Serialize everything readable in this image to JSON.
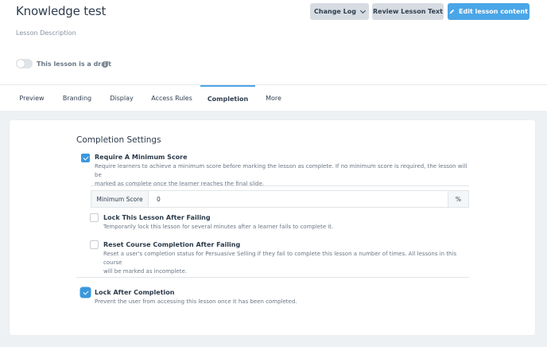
{
  "header": {
    "title": "Knowledge test",
    "description": "Lesson Description",
    "change_log_label": "Change Log",
    "review_label": "Review Lesson Text",
    "edit_label": "Edit lesson content",
    "draft_label": "This lesson is a draft",
    "draft_enabled": false,
    "info_glyph": "i"
  },
  "tabs": [
    {
      "label": "Preview"
    },
    {
      "label": "Branding"
    },
    {
      "label": "Display"
    },
    {
      "label": "Access Rules"
    },
    {
      "label": "Completion",
      "active": true
    },
    {
      "label": "More"
    }
  ],
  "completion": {
    "title": "Completion Settings",
    "min_score": {
      "checked": true,
      "title": "Require A Minimum Score",
      "desc_line1": "Require learners to achieve a minimum score before marking the lesson as complete. If no minimum score is required, the lesson will be",
      "desc_line2": "marked as complete once the learner reaches the final slide.",
      "field_label": "Minimum Score",
      "field_value": "0",
      "field_unit": "%"
    },
    "lock_fail": {
      "checked": false,
      "title": "Lock This Lesson After Failing",
      "desc": "Temporarily lock this lesson for several minutes after a learner fails to complete it."
    },
    "reset_fail": {
      "checked": false,
      "title": "Reset Course Completion After Failing",
      "desc_line1": "Reset a user's completion status for Persuasive Selling if they fail to complete this lesson a number of times. All lessons in this course",
      "desc_line2": "will be marked as incomplete."
    },
    "lock_complete": {
      "checked": true,
      "title": "Lock After Completion",
      "desc": "Prevent the user from accessing this lesson once it has been completed."
    }
  },
  "colors": {
    "accent": "#4aa6e7",
    "checkbox": "#3b97dd",
    "button_gray": "#d6dce2",
    "content_bg": "#eef1f4"
  }
}
